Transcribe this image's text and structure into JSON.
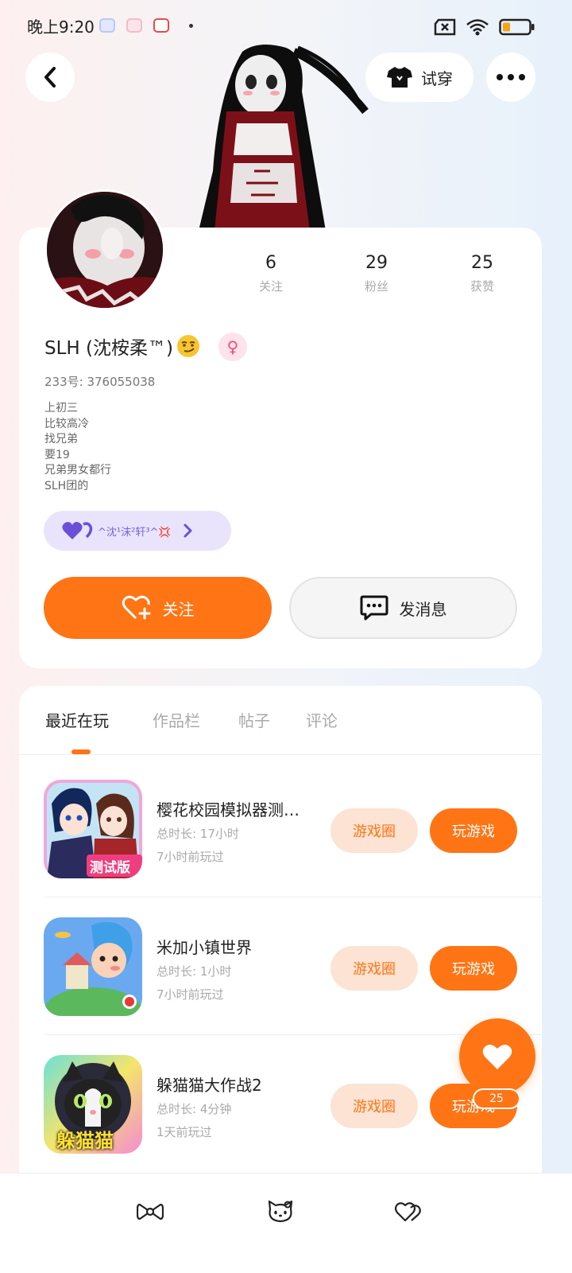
{
  "status_bar": {
    "time": "晚上9:20",
    "battery_color": "#f2a51a"
  },
  "header": {
    "tryon_label": "试穿"
  },
  "profile": {
    "stats": [
      {
        "value": "6",
        "label": "关注"
      },
      {
        "value": "29",
        "label": "粉丝"
      },
      {
        "value": "25",
        "label": "获赞"
      }
    ],
    "username": "SLH (沈桉柔™)",
    "gender_symbol": "♀",
    "uid": "233号: 376055038",
    "bio_lines": [
      "上初三",
      "比较高冷",
      "找兄弟",
      "要19",
      "兄弟男女都行",
      "SLH团的"
    ],
    "fan_badge": "^沈¹沫²轩³^💢",
    "follow_label": "关注",
    "message_label": "发消息"
  },
  "tabs": [
    {
      "label": "最近在玩",
      "active": true
    },
    {
      "label": "作品栏",
      "active": false
    },
    {
      "label": "帖子",
      "active": false
    },
    {
      "label": "评论",
      "active": false
    }
  ],
  "games": [
    {
      "name": "樱花校园模拟器测…",
      "duration": "总时长: 17小时",
      "last_played": "7小时前玩过",
      "icon": "sakura-school-icon",
      "badge": "测试版"
    },
    {
      "name": "米加小镇世界",
      "duration": "总时长: 1小时",
      "last_played": "7小时前玩过",
      "icon": "toca-world-icon"
    },
    {
      "name": "躲猫猫大作战2",
      "duration": "总时长: 4分钟",
      "last_played": "1天前玩过",
      "icon": "hide-cat-icon",
      "badge": "躲猫猫"
    }
  ],
  "game_actions": {
    "circle_label": "游戏圈",
    "play_label": "玩游戏"
  },
  "like": {
    "count": "25"
  },
  "colors": {
    "accent": "#ff7414",
    "accent_light": "#fde3d3",
    "badge_purple": "#7663d6"
  }
}
